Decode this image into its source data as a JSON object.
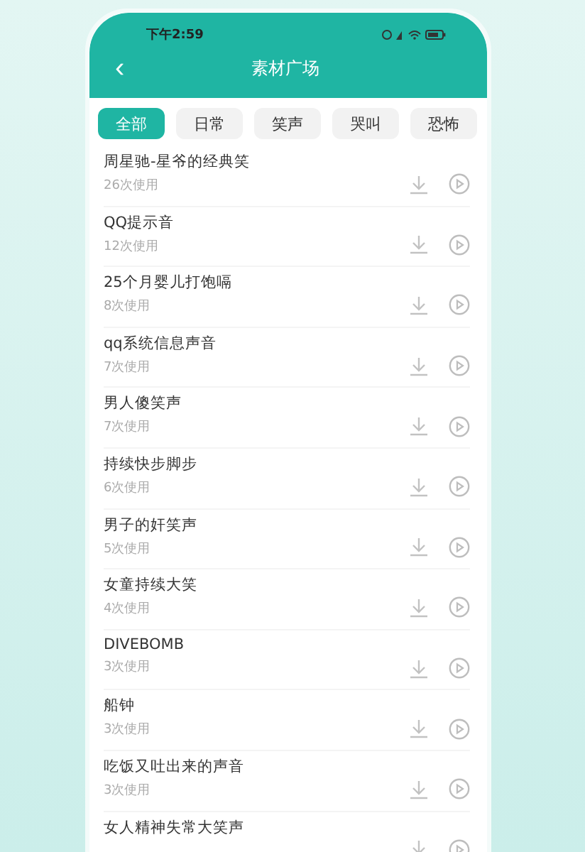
{
  "status_bar": {
    "time": "下午2:59"
  },
  "header": {
    "back": "‹",
    "title": "素材广场"
  },
  "tabs": [
    {
      "label": "全部",
      "selected": true
    },
    {
      "label": "日常",
      "selected": false
    },
    {
      "label": "笑声",
      "selected": false
    },
    {
      "label": "哭叫",
      "selected": false
    },
    {
      "label": "恐怖",
      "selected": false
    }
  ],
  "items": [
    {
      "title": "周星驰-星爷的经典笑",
      "usage": "26次使用"
    },
    {
      "title": "QQ提示音",
      "usage": "12次使用"
    },
    {
      "title": "25个月婴儿打饱嗝",
      "usage": "8次使用"
    },
    {
      "title": "qq系统信息声音",
      "usage": "7次使用"
    },
    {
      "title": "男人傻笑声",
      "usage": "7次使用"
    },
    {
      "title": "持续快步脚步",
      "usage": "6次使用"
    },
    {
      "title": "男子的奸笑声",
      "usage": "5次使用"
    },
    {
      "title": "女童持续大笑",
      "usage": "4次使用"
    },
    {
      "title": "DIVEBOMB",
      "usage": "3次使用"
    },
    {
      "title": "船钟",
      "usage": "3次使用"
    },
    {
      "title": "吃饭又吐出来的声音",
      "usage": "3次使用"
    },
    {
      "title": "女人精神失常大笑声"
    }
  ]
}
